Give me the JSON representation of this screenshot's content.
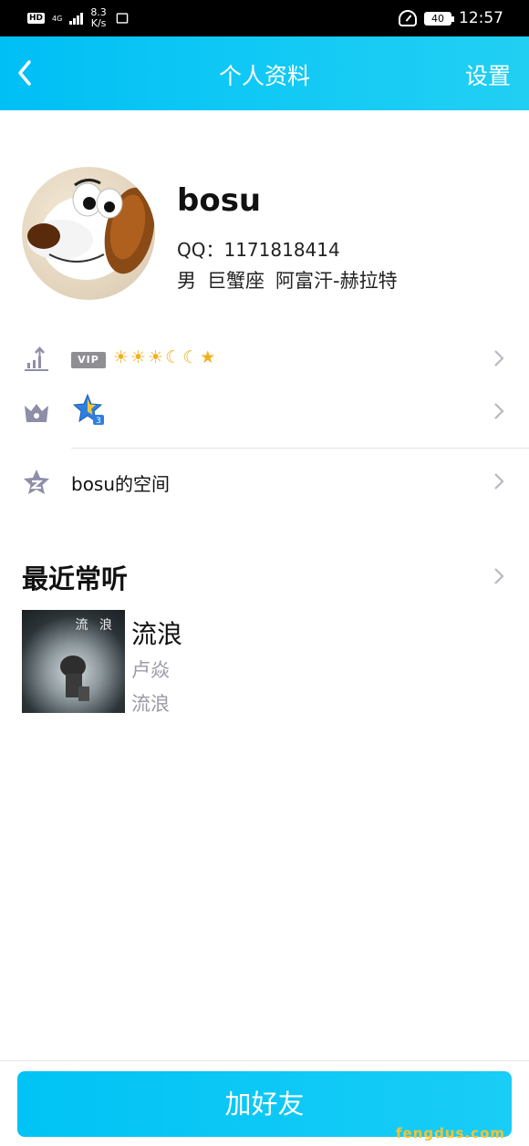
{
  "status_bar": {
    "hd": "HD",
    "network": "4G",
    "speed_value": "8.3",
    "speed_unit": "K/s",
    "battery": "40",
    "time": "12:57"
  },
  "header": {
    "title": "个人资料",
    "settings_label": "设置"
  },
  "profile": {
    "username": "bosu",
    "qq": "QQ：1171818414",
    "gender": "男",
    "zodiac": "巨蟹座",
    "location": "阿富汗-赫拉特"
  },
  "rows": {
    "vip_badge": "VIP",
    "level_icons": [
      "sun-icon",
      "sun-icon",
      "sun-icon",
      "moon-icon",
      "moon-icon",
      "star-icon"
    ],
    "space_label": "bosu的空间"
  },
  "recent": {
    "section_title": "最近常听",
    "cover_text": "流 浪",
    "song_title": "流浪",
    "artist": "卢焱",
    "album": "流浪"
  },
  "bottom": {
    "add_friend_label": "加好友"
  },
  "watermark": "fengdus.com",
  "colors": {
    "header_gradient_start": "#00bff5",
    "header_gradient_end": "#22cff3",
    "icon_gray": "#8e8ea8",
    "chevron_gray": "#b8b8c0",
    "secondary_text": "#9a9aa5"
  }
}
